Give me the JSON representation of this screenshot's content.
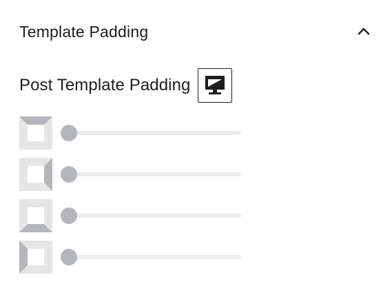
{
  "panel": {
    "title": "Template Padding",
    "collapse_icon": "chevron-up-icon"
  },
  "setting": {
    "label": "Post Template Padding",
    "device_icon": "desktop-icon"
  },
  "padding": {
    "top": {
      "icon": "padding-top-icon",
      "value": 0
    },
    "right": {
      "icon": "padding-right-icon",
      "value": 0
    },
    "bottom": {
      "icon": "padding-bottom-icon",
      "value": 0
    },
    "left": {
      "icon": "padding-left-icon",
      "value": 0
    }
  },
  "colors": {
    "text": "#1e1e1e",
    "icon_light": "#e6e6e6",
    "icon_active": "#b4b6b9",
    "track": "#ececec",
    "thumb": "#b4b6b9"
  }
}
